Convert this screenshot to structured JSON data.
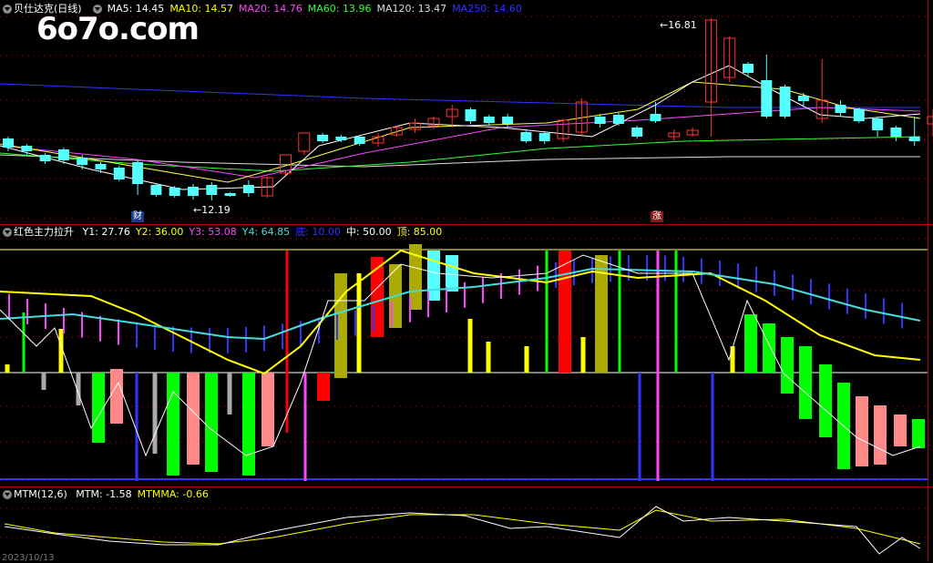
{
  "panel_main": {
    "stock_name": "贝仕达克(日线)",
    "ma": [
      {
        "label": "MA5: 14.45",
        "color": "#ffffff"
      },
      {
        "label": "MA10: 14.57",
        "color": "#ffff00"
      },
      {
        "label": "MA20: 14.76",
        "color": "#ff44ff"
      },
      {
        "label": "MA60: 13.96",
        "color": "#33ff33"
      },
      {
        "label": "MA120: 13.47",
        "color": "#dddddd"
      },
      {
        "label": "MA250: 14.60",
        "color": "#3333ff"
      }
    ],
    "high_label": "16.81",
    "low_label": "12.19",
    "tag_left": "财",
    "tag_right": "涨"
  },
  "watermark": "6o7o.com",
  "panel_indicator": {
    "name": "红色主力拉升",
    "values": [
      {
        "label": "Y1: 27.76",
        "color": "#ffffff"
      },
      {
        "label": "Y2: 36.00",
        "color": "#ffff00"
      },
      {
        "label": "Y3: 53.08",
        "color": "#ff44ff"
      },
      {
        "label": "Y4: 64.85",
        "color": "#44dddd"
      },
      {
        "label": "底: 10.00",
        "color": "#3333ff"
      },
      {
        "label": "中: 50.00",
        "color": "#ffffff"
      },
      {
        "label": "顶: 85.00",
        "color": "#ffff00"
      }
    ]
  },
  "panel_mtm": {
    "name": "MTM(12,6)",
    "values": [
      {
        "label": "MTM: -1.58",
        "color": "#ffffff"
      },
      {
        "label": "MTMMA: -0.66",
        "color": "#ffff00"
      }
    ]
  },
  "date_text": "2023/10/13",
  "colors": {
    "up": "#ff3333",
    "down": "#54ffff",
    "grid": "#8b0000"
  }
}
